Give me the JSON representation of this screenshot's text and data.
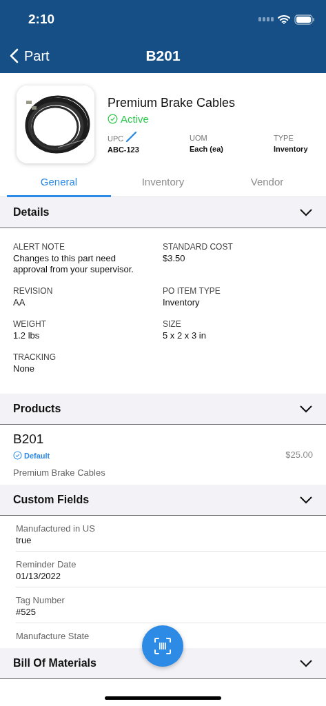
{
  "status_bar": {
    "time": "2:10"
  },
  "nav": {
    "back_label": "Part",
    "title": "B201"
  },
  "part": {
    "name": "Premium Brake Cables",
    "status": "Active",
    "attributes": [
      {
        "label": "UPC",
        "value": "ABC-123",
        "editable": true
      },
      {
        "label": "UOM",
        "value": "Each (ea)",
        "editable": false
      },
      {
        "label": "TYPE",
        "value": "Inventory",
        "editable": false
      }
    ]
  },
  "tabs": [
    {
      "label": "General",
      "selected": true
    },
    {
      "label": "Inventory",
      "selected": false
    },
    {
      "label": "Vendor",
      "selected": false
    }
  ],
  "sections": [
    {
      "title": "Details",
      "kind": "fields",
      "fields": [
        {
          "label": "ALERT NOTE",
          "value": "Changes to this part need approval from your supervisor."
        },
        {
          "label": "STANDARD COST",
          "value": "$3.50"
        },
        {
          "label": "REVISION",
          "value": "AA"
        },
        {
          "label": "PO ITEM TYPE",
          "value": "Inventory"
        },
        {
          "label": "WEIGHT",
          "value": "1.2 lbs"
        },
        {
          "label": "SIZE",
          "value": "5 x 2 x 3 in"
        },
        {
          "label": "TRACKING",
          "value": "None"
        }
      ]
    },
    {
      "title": "Products",
      "kind": "products",
      "items": [
        {
          "code": "B201",
          "badge": "Default",
          "description": "Premium Brake Cables",
          "price": "$25.00"
        }
      ]
    },
    {
      "title": "Custom Fields",
      "kind": "custom",
      "fields": [
        {
          "label": "Manufactured in US",
          "value": "true"
        },
        {
          "label": "Reminder Date",
          "value": "01/13/2022"
        },
        {
          "label": "Tag Number",
          "value": "#525"
        },
        {
          "label": "Manufacture State"
        }
      ]
    },
    {
      "title": "Bill Of Materials",
      "kind": "collapsed"
    }
  ]
}
